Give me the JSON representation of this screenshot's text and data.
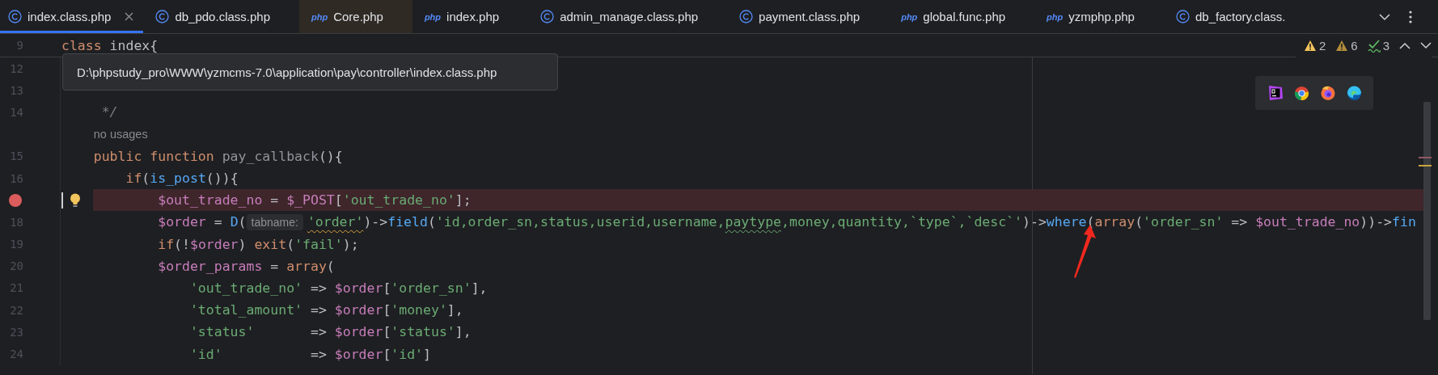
{
  "tabs": [
    {
      "label": "index.class.php",
      "kind": "class",
      "selected": true,
      "tinted": false
    },
    {
      "label": "db_pdo.class.php",
      "kind": "class",
      "selected": false,
      "tinted": false
    },
    {
      "label": "Core.php",
      "kind": "php",
      "badge": "php",
      "selected": false,
      "tinted": true
    },
    {
      "label": "index.php",
      "kind": "php",
      "badge": "php",
      "selected": false,
      "tinted": false
    },
    {
      "label": "admin_manage.class.php",
      "kind": "class",
      "selected": false,
      "tinted": false
    },
    {
      "label": "payment.class.php",
      "kind": "class",
      "selected": false,
      "tinted": false
    },
    {
      "label": "global.func.php",
      "kind": "php",
      "badge": "php",
      "selected": false,
      "tinted": false
    },
    {
      "label": "yzmphp.php",
      "kind": "php",
      "badge": "php",
      "selected": false,
      "tinted": false
    },
    {
      "label": "db_factory.class.",
      "kind": "class",
      "selected": false,
      "tinted": false
    }
  ],
  "sticky_line": {
    "number": "9",
    "tokens": [
      {
        "text": "class",
        "kind": "kw"
      },
      {
        "text": " index{",
        "kind": "plain"
      }
    ]
  },
  "path_tooltip": "D:\\phpstudy_pro\\WWW\\yzmcms-7.0\\application\\pay\\controller\\index.class.php",
  "inspections": [
    {
      "kind": "warning",
      "count": "2"
    },
    {
      "kind": "weak_warning",
      "count": "6"
    },
    {
      "kind": "typo",
      "count": "3"
    }
  ],
  "browsers": [
    {
      "kind": "ide"
    },
    {
      "kind": "chrome"
    },
    {
      "kind": "firefox"
    },
    {
      "kind": "edge"
    }
  ],
  "lines": [
    {
      "number": "12"
    },
    {
      "number": "13"
    },
    {
      "number": "14",
      "tokens": [
        {
          "text": "*/",
          "kind": "com"
        }
      ]
    },
    {
      "tokens": [
        {
          "text": "no usages",
          "kind": "hint"
        }
      ]
    },
    {
      "number": "15",
      "tokens": [
        {
          "text": "public function ",
          "kind": "kw"
        },
        {
          "text": "pay_callback",
          "kind": "dim"
        },
        {
          "text": "(){",
          "kind": "plain"
        }
      ],
      "children": [
        {
          "number": "16",
          "tokens": [
            {
              "text": "if",
              "kind": "kw"
            },
            {
              "text": "(",
              "kind": "plain"
            },
            {
              "text": "is_post",
              "kind": "fn"
            },
            {
              "text": "()){",
              "kind": "plain"
            }
          ],
          "children": [
            {
              "breakpoint": true,
              "bulb": true,
              "caret": true,
              "tokens": [
                {
                  "text": "$out_trade_no",
                  "kind": "var"
                },
                {
                  "text": " = ",
                  "kind": "plain"
                },
                {
                  "text": "$_POST",
                  "kind": "var"
                },
                {
                  "text": "[",
                  "kind": "plain"
                },
                {
                  "text": "'out_trade_no'",
                  "kind": "str"
                },
                {
                  "text": "];",
                  "kind": "plain"
                }
              ]
            },
            {
              "number": "18",
              "tokens": [
                {
                  "text": "$order",
                  "kind": "var"
                },
                {
                  "text": " = ",
                  "kind": "plain"
                },
                {
                  "text": "D",
                  "kind": "fn"
                },
                {
                  "text": "(",
                  "kind": "plain"
                },
                {
                  "text": "tabname:",
                  "kind": "inlay"
                },
                {
                  "text": "'order'",
                  "kind": "str",
                  "warned": true
                },
                {
                  "text": ")->",
                  "kind": "plain"
                },
                {
                  "text": "field",
                  "kind": "fn"
                },
                {
                  "text": "(",
                  "kind": "plain"
                },
                {
                  "text": "'id,order_sn,status,userid,username,",
                  "kind": "str"
                },
                {
                  "text": "paytype",
                  "kind": "str",
                  "misspelled": true
                },
                {
                  "text": ",money,quantity,`type`,`desc`'",
                  "kind": "str"
                },
                {
                  "text": ")->",
                  "kind": "plain"
                },
                {
                  "text": "where",
                  "kind": "fn"
                },
                {
                  "text": "(",
                  "kind": "plain"
                },
                {
                  "text": "array",
                  "kind": "kw"
                },
                {
                  "text": "(",
                  "kind": "plain"
                },
                {
                  "text": "'order_sn'",
                  "kind": "str"
                },
                {
                  "text": " => ",
                  "kind": "plain"
                },
                {
                  "text": "$out_trade_no",
                  "kind": "var"
                },
                {
                  "text": "))->",
                  "kind": "plain"
                },
                {
                  "text": "fin",
                  "kind": "fn"
                }
              ]
            },
            {
              "number": "19",
              "tokens": [
                {
                  "text": "if",
                  "kind": "kw"
                },
                {
                  "text": "(!",
                  "kind": "plain"
                },
                {
                  "text": "$order",
                  "kind": "var"
                },
                {
                  "text": ") ",
                  "kind": "plain"
                },
                {
                  "text": "exit",
                  "kind": "kw"
                },
                {
                  "text": "(",
                  "kind": "plain"
                },
                {
                  "text": "'fail'",
                  "kind": "str"
                },
                {
                  "text": ");",
                  "kind": "plain"
                }
              ]
            },
            {
              "number": "20",
              "tokens": [
                {
                  "text": "$order_params",
                  "kind": "var"
                },
                {
                  "text": " = ",
                  "kind": "plain"
                },
                {
                  "text": "array",
                  "kind": "kw"
                },
                {
                  "text": "(",
                  "kind": "plain"
                }
              ],
              "children": [
                {
                  "number": "21",
                  "tokens": [
                    {
                      "text": "'out_trade_no'",
                      "kind": "str"
                    },
                    {
                      "text": " => ",
                      "kind": "plain"
                    },
                    {
                      "text": "$order",
                      "kind": "var"
                    },
                    {
                      "text": "[",
                      "kind": "plain"
                    },
                    {
                      "text": "'order_sn'",
                      "kind": "str"
                    },
                    {
                      "text": "],",
                      "kind": "plain"
                    }
                  ]
                },
                {
                  "number": "22",
                  "tokens": [
                    {
                      "text": "'total_amount'",
                      "kind": "str"
                    },
                    {
                      "text": " => ",
                      "kind": "plain"
                    },
                    {
                      "text": "$order",
                      "kind": "var"
                    },
                    {
                      "text": "[",
                      "kind": "plain"
                    },
                    {
                      "text": "'money'",
                      "kind": "str"
                    },
                    {
                      "text": "],",
                      "kind": "plain"
                    }
                  ]
                },
                {
                  "number": "23",
                  "tokens": [
                    {
                      "text": "'status'",
                      "kind": "str"
                    },
                    {
                      "text": "       => ",
                      "kind": "plain"
                    },
                    {
                      "text": "$order",
                      "kind": "var"
                    },
                    {
                      "text": "[",
                      "kind": "plain"
                    },
                    {
                      "text": "'status'",
                      "kind": "str"
                    },
                    {
                      "text": "],",
                      "kind": "plain"
                    }
                  ]
                },
                {
                  "number": "24",
                  "tokens": [
                    {
                      "text": "'id'",
                      "kind": "str"
                    },
                    {
                      "text": "           => ",
                      "kind": "plain"
                    },
                    {
                      "text": "$order",
                      "kind": "var"
                    },
                    {
                      "text": "[",
                      "kind": "plain"
                    },
                    {
                      "text": "'id'",
                      "kind": "str"
                    },
                    {
                      "text": "]",
                      "kind": "plain"
                    }
                  ]
                }
              ]
            }
          ]
        }
      ]
    }
  ]
}
